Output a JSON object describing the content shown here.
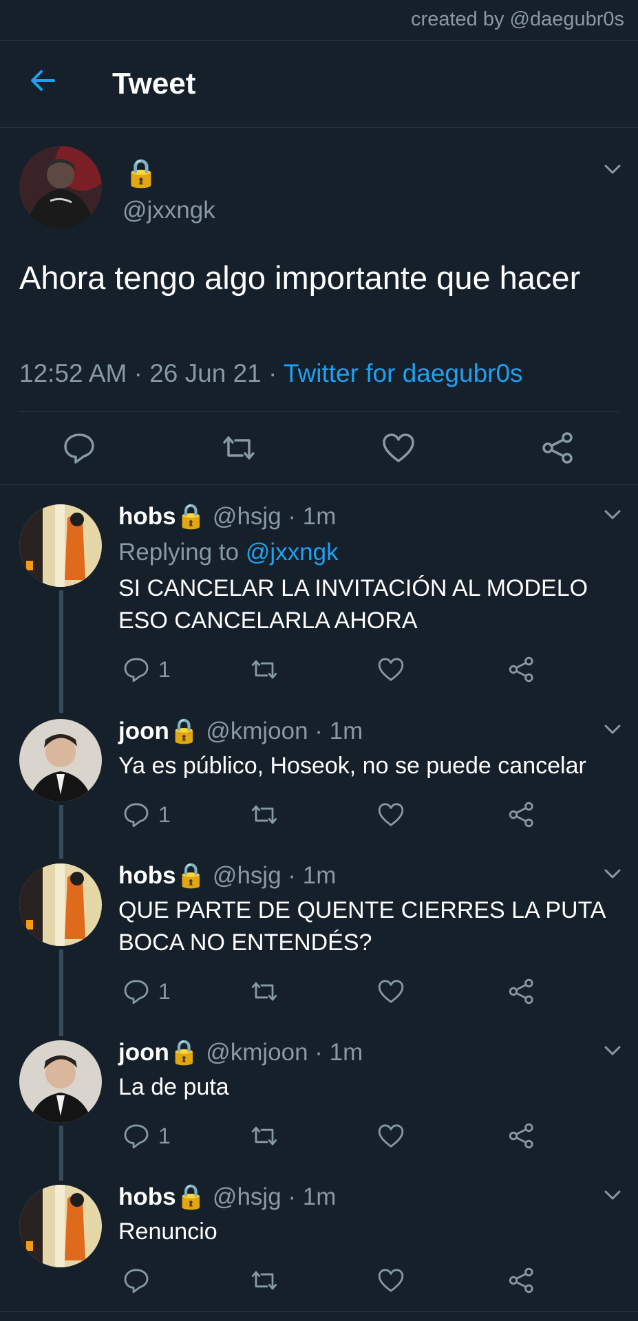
{
  "credit": "created by @daegubr0s",
  "header": {
    "title": "Tweet"
  },
  "main_tweet": {
    "name": "🔒",
    "handle": "@jxxngk",
    "text": "Ahora tengo algo importante que hacer",
    "time": "12:52 AM",
    "date": "26 Jun 21",
    "separator": "·",
    "source": "Twitter for daegubr0s"
  },
  "replies": [
    {
      "name": "hobs🔒",
      "handle": "@hsjg",
      "time": "1m",
      "replying_label": "Replying to",
      "replying_to": "@jxxngk",
      "text": "SI CANCELAR LA INVITACIÓN AL MODELO ESO CANCELARLA AHORA",
      "reply_count": "1"
    },
    {
      "name": "joon🔒",
      "handle": "@kmjoon",
      "time": "1m",
      "text": "Ya es público, Hoseok, no se puede cancelar",
      "reply_count": "1"
    },
    {
      "name": "hobs🔒",
      "handle": "@hsjg",
      "time": "1m",
      "text": "QUE PARTE DE QUENTE CIERRES LA PUTA BOCA NO ENTENDÉS?",
      "reply_count": "1"
    },
    {
      "name": "joon🔒",
      "handle": "@kmjoon",
      "time": "1m",
      "text": "La de puta",
      "reply_count": "1"
    },
    {
      "name": "hobs🔒",
      "handle": "@hsjg",
      "time": "1m",
      "text": "Renuncio",
      "reply_count": ""
    }
  ],
  "colors": {
    "background": "#15202b",
    "accent": "#1da1f2",
    "muted": "#8899a6",
    "divider": "#2b3742"
  },
  "icons": [
    "back-arrow-icon",
    "chevron-down-icon",
    "reply-icon",
    "retweet-icon",
    "like-icon",
    "share-icon",
    "lock-icon"
  ]
}
